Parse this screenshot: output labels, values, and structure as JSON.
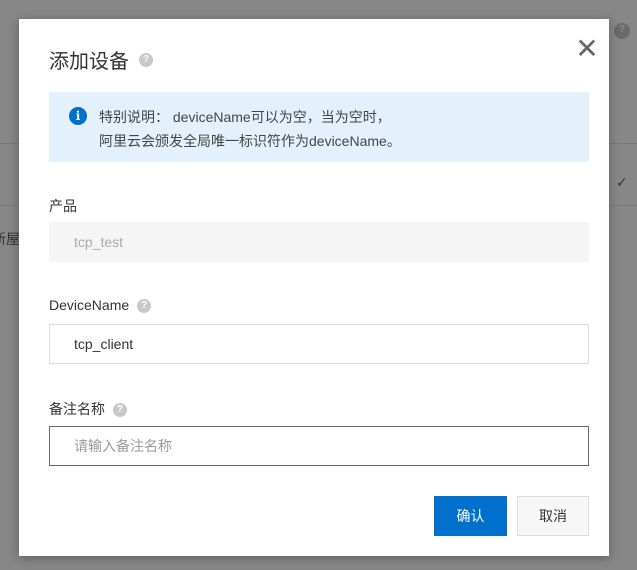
{
  "background": {
    "partial_text": "新屋",
    "check": "✓",
    "help": "?"
  },
  "dialog": {
    "title": "添加设备",
    "help": "?",
    "close": "✕",
    "notice": {
      "icon": "i",
      "line1": "特别说明： deviceName可以为空，当为空时，",
      "line2": "阿里云会颁发全局唯一标识符作为deviceName。"
    },
    "product": {
      "label": "产品",
      "value": "tcp_test"
    },
    "device_name": {
      "label": "DeviceName",
      "value": "tcp_client"
    },
    "remark": {
      "label": "备注名称",
      "placeholder": "请输入备注名称",
      "value": ""
    },
    "confirm_label": "确认",
    "cancel_label": "取消"
  }
}
